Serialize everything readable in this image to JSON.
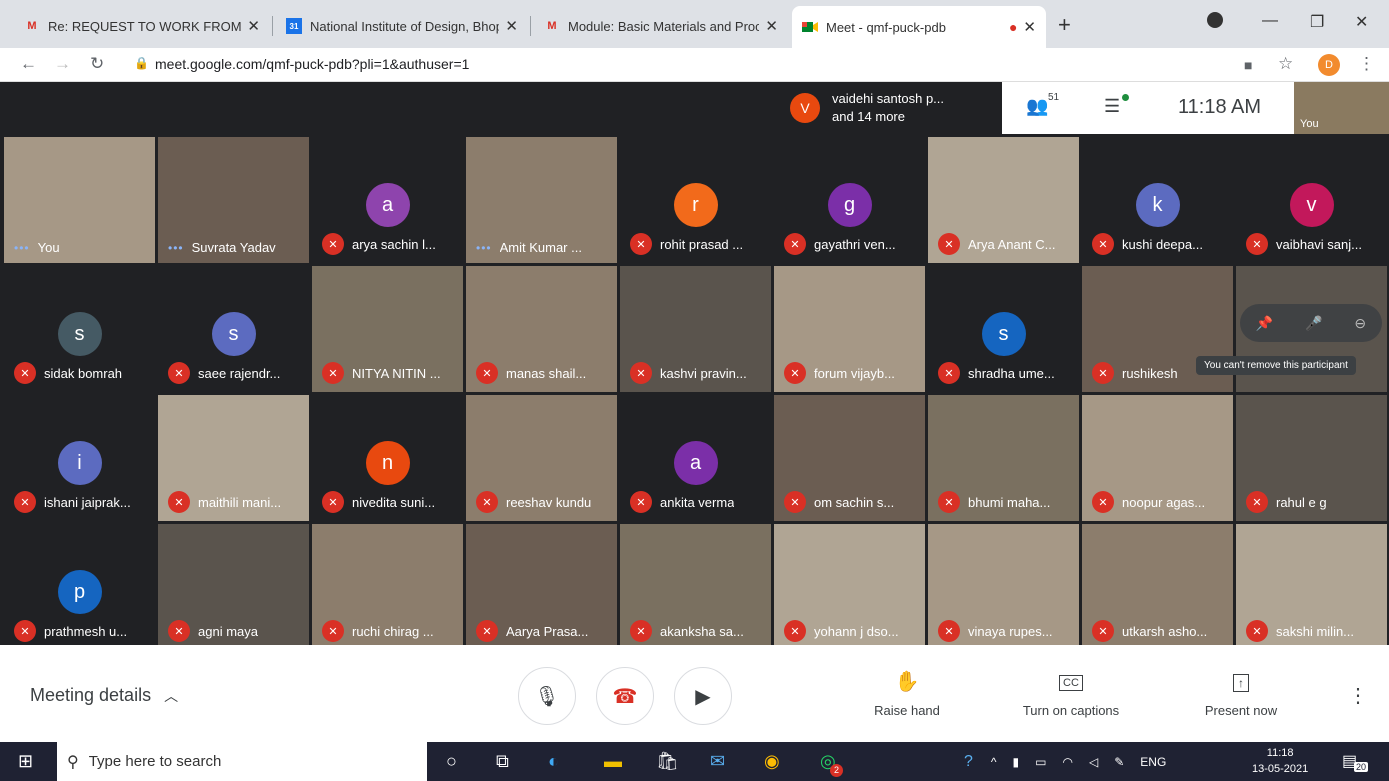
{
  "browser": {
    "tabs": [
      {
        "icon": "M",
        "label": "Re: REQUEST TO WORK FROM H"
      },
      {
        "icon": "31",
        "label": "National Institute of Design, Bhop"
      },
      {
        "icon": "M",
        "label": "Module: Basic Materials and Proc"
      },
      {
        "icon": "meet",
        "label": "Meet - qmf-puck-pdb"
      }
    ],
    "url": "meet.google.com/qmf-puck-pdb?pli=1&authuser=1",
    "profile_initial": "D"
  },
  "meet": {
    "presenter_initial": "V",
    "presenter_line1": "vaidehi santosh p...",
    "presenter_line2": "and 14 more",
    "participant_count": "51",
    "time": "11:18 AM",
    "self_label": "You",
    "tooltip": "You can't remove this participant",
    "tiles": [
      {
        "name": "You",
        "initial": "",
        "color": "",
        "style": "v3",
        "state": "speaking"
      },
      {
        "name": "Suvrata Yadav",
        "initial": "",
        "color": "",
        "style": "v2",
        "state": "speaking"
      },
      {
        "name": "arya sachin l...",
        "initial": "a",
        "color": "#8e44ad",
        "style": "dark",
        "state": "muted"
      },
      {
        "name": "Amit Kumar ...",
        "initial": "",
        "color": "",
        "style": "v1",
        "state": "speaking"
      },
      {
        "name": "rohit prasad ...",
        "initial": "r",
        "color": "#f26a1b",
        "style": "dark",
        "state": "muted"
      },
      {
        "name": "gayathri ven...",
        "initial": "g",
        "color": "#7b2fa8",
        "style": "dark",
        "state": "muted"
      },
      {
        "name": "Arya Anant C...",
        "initial": "",
        "color": "",
        "style": "v5",
        "state": "muted"
      },
      {
        "name": "kushi deepa...",
        "initial": "k",
        "color": "#5c6bc0",
        "style": "dark",
        "state": "muted"
      },
      {
        "name": "vaibhavi sanj...",
        "initial": "v",
        "color": "#c2185b",
        "style": "dark",
        "state": "muted"
      },
      {
        "name": "sidak bomrah",
        "initial": "s",
        "color": "#455a64",
        "style": "dark",
        "state": "muted"
      },
      {
        "name": "saee rajendr...",
        "initial": "s",
        "color": "#5c6bc0",
        "style": "dark",
        "state": "muted"
      },
      {
        "name": "NITYA NITIN ...",
        "initial": "",
        "color": "",
        "style": "v6",
        "state": "muted"
      },
      {
        "name": "manas shail...",
        "initial": "",
        "color": "",
        "style": "v1",
        "state": "muted"
      },
      {
        "name": "kashvi pravin...",
        "initial": "",
        "color": "",
        "style": "v4",
        "state": "muted"
      },
      {
        "name": "forum vijayb...",
        "initial": "",
        "color": "",
        "style": "v3",
        "state": "muted"
      },
      {
        "name": "shradha ume...",
        "initial": "s",
        "color": "#1565c0",
        "style": "dark",
        "state": "muted"
      },
      {
        "name": "rushikesh",
        "initial": "",
        "color": "",
        "style": "v2",
        "state": "muted"
      },
      {
        "name": "",
        "initial": "",
        "color": "",
        "style": "v4",
        "state": "none"
      },
      {
        "name": "ishani jaiprak...",
        "initial": "i",
        "color": "#5c6bc0",
        "style": "dark",
        "state": "muted"
      },
      {
        "name": "maithili mani...",
        "initial": "",
        "color": "",
        "style": "v5",
        "state": "muted"
      },
      {
        "name": "nivedita suni...",
        "initial": "n",
        "color": "#e8490f",
        "style": "dark",
        "state": "muted"
      },
      {
        "name": "reeshav kundu",
        "initial": "",
        "color": "",
        "style": "v1",
        "state": "muted"
      },
      {
        "name": "ankita verma",
        "initial": "a",
        "color": "#7b2fa8",
        "style": "dark",
        "state": "muted"
      },
      {
        "name": "om sachin s...",
        "initial": "",
        "color": "",
        "style": "v2",
        "state": "muted"
      },
      {
        "name": "bhumi maha...",
        "initial": "",
        "color": "",
        "style": "v6",
        "state": "muted"
      },
      {
        "name": "noopur agas...",
        "initial": "",
        "color": "",
        "style": "v3",
        "state": "muted"
      },
      {
        "name": "rahul e g",
        "initial": "",
        "color": "",
        "style": "v4",
        "state": "muted"
      },
      {
        "name": "prathmesh u...",
        "initial": "p",
        "color": "#1565c0",
        "style": "dark",
        "state": "muted"
      },
      {
        "name": "agni maya",
        "initial": "",
        "color": "",
        "style": "v4",
        "state": "muted"
      },
      {
        "name": "ruchi chirag ...",
        "initial": "",
        "color": "",
        "style": "v1",
        "state": "muted"
      },
      {
        "name": "Aarya Prasa...",
        "initial": "",
        "color": "",
        "style": "v2",
        "state": "muted"
      },
      {
        "name": "akanksha sa...",
        "initial": "",
        "color": "",
        "style": "v6",
        "state": "muted"
      },
      {
        "name": "yohann j dso...",
        "initial": "",
        "color": "",
        "style": "v5",
        "state": "muted"
      },
      {
        "name": "vinaya rupes...",
        "initial": "",
        "color": "",
        "style": "v3",
        "state": "muted"
      },
      {
        "name": "utkarsh asho...",
        "initial": "",
        "color": "",
        "style": "v1",
        "state": "muted"
      },
      {
        "name": "sakshi milin...",
        "initial": "",
        "color": "",
        "style": "v5",
        "state": "muted"
      }
    ]
  },
  "controls": {
    "meeting_details": "Meeting details",
    "raise_hand": "Raise hand",
    "captions": "Turn on captions",
    "present": "Present now"
  },
  "taskbar": {
    "search_placeholder": "Type here to search",
    "lang": "ENG",
    "time": "11:18",
    "date": "13-05-2021",
    "notifications": "20",
    "whatsapp_badge": "2"
  }
}
